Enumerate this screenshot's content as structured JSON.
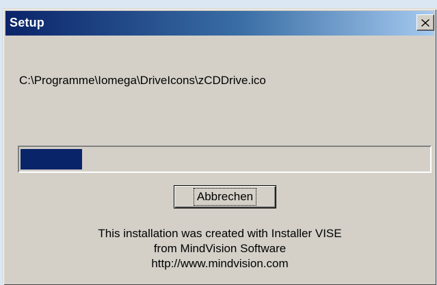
{
  "window": {
    "title": "Setup",
    "close_icon": "close-icon"
  },
  "main": {
    "current_file": "C:\\Programme\\Iomega\\DriveIcons\\zCDDrive.ico",
    "progress_percent": 15,
    "cancel_label": "Abbrechen"
  },
  "footer": {
    "line1": "This installation was created with Installer VISE",
    "line2": "from MindVision Software",
    "line3": "http://www.mindvision.com"
  },
  "colors": {
    "titlebar_start": "#0a246a",
    "titlebar_end": "#a6caf0",
    "progress_fill": "#0a246a",
    "dialog_bg": "#d4d0c8"
  }
}
